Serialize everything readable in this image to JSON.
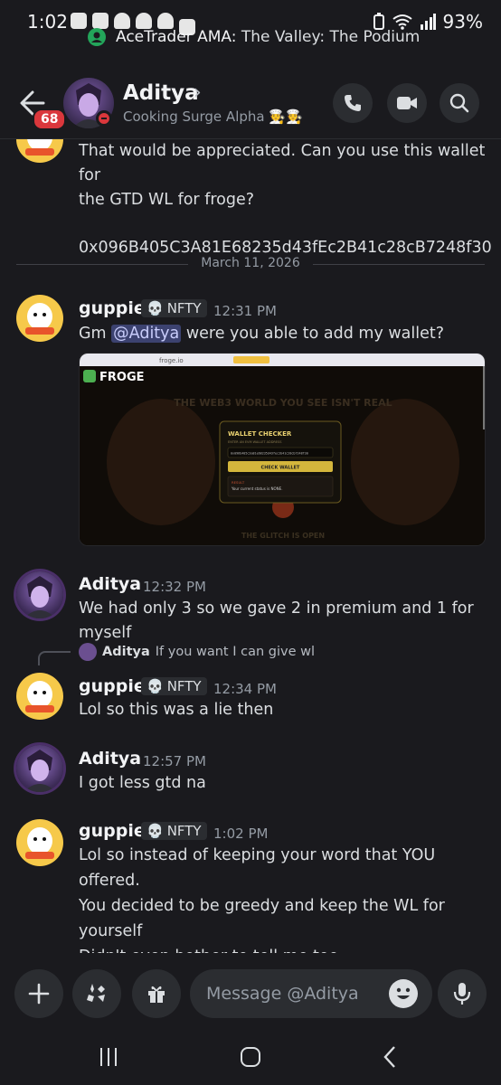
{
  "status_bar": {
    "time": "1:02",
    "battery": "93%"
  },
  "live_banner": {
    "app": "AceTrader AMA:",
    "channel": "The Valley: The Podium"
  },
  "header": {
    "unread_count": "68",
    "name": "Aditya",
    "status_text": "Cooking Surge Alpha",
    "status_emoji": "🧑‍🍳🧑‍🍳"
  },
  "messages": {
    "prev_text_1": "That would be appreciated. Can you use this wallet for",
    "prev_text_2": "the GTD WL for froge?",
    "prev_text_3": "0x096B405C3A81E68235d43fEc2B41c28cB7248f30",
    "date_divider": "March 11, 2026",
    "m1": {
      "author": "guppie",
      "badge": "NFTY",
      "time": "12:31 PM",
      "text_before": "Gm ",
      "mention": "@Aditya",
      "text_after": " were you able to add my wallet?"
    },
    "embed": {
      "brand": "FROGE",
      "headline": "THE WEB3 WORLD YOU SEE ISN'T REAL",
      "panel_title": "WALLET CHECKER",
      "panel_sub": "ENTER AN EVM WALLET ADDRESS",
      "panel_address": "0x096b405c3a81e68235d43fec2b41c28cb7248f30",
      "panel_button": "CHECK WALLET",
      "result_label": "RESULT",
      "result_text": "Your current status is NONE.",
      "footer": "THE GLITCH IS OPEN",
      "url": "froge.io"
    },
    "m2": {
      "author": "Aditya",
      "time": "12:32 PM",
      "text": "We had only 3 so we gave 2 in premium and 1 for myself"
    },
    "reply": {
      "author": "Aditya",
      "text": "If you want I can give wl"
    },
    "m3": {
      "author": "guppie",
      "badge": "NFTY",
      "time": "12:34 PM",
      "text": "Lol so this was a lie then"
    },
    "m4": {
      "author": "Aditya",
      "time": "12:57 PM",
      "text": "I got less gtd na"
    },
    "m5": {
      "author": "guppie",
      "badge": "NFTY",
      "time": "1:02 PM",
      "line1": "Lol so instead of keeping your word that YOU offered.",
      "line2": "You decided to be greedy and keep the WL for yourself",
      "line3": "Didn't even bother to tell me too"
    }
  },
  "composer": {
    "placeholder": "Message @Aditya"
  },
  "colors": {
    "background": "#1a1a1e",
    "mention_bg": "#3c4270",
    "dnd_red": "#da373c",
    "badge_gold": "#f0b232"
  }
}
